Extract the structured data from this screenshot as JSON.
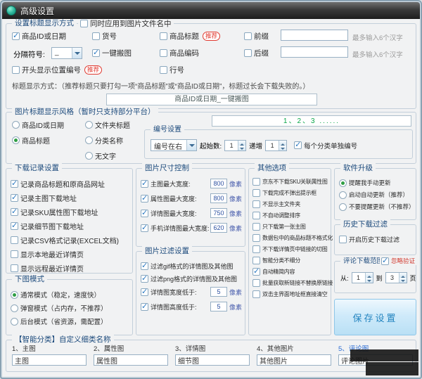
{
  "window": {
    "title": "高级设置"
  },
  "badges": {
    "recommend": "推荐"
  },
  "units": {
    "pixel": "像素",
    "max6": "最多输入6个汉字",
    "page": "页"
  },
  "title_setting": {
    "group_title": "设置标题显示方式",
    "apply_to_filename": {
      "label": "同时应用到图片文件名中",
      "checked": false
    },
    "id_date": {
      "label": "商品ID或日期",
      "checked": true
    },
    "item_no": {
      "label": "货号",
      "checked": false
    },
    "product_title": {
      "label": "商品标题",
      "checked": false
    },
    "prefix": {
      "label": "前缀",
      "checked": false,
      "value": ""
    },
    "separator": {
      "label": "分隔符号:",
      "value": "_"
    },
    "one_key": {
      "label": "一键搬图",
      "checked": true
    },
    "product_code": {
      "label": "商品编码",
      "checked": false
    },
    "suffix": {
      "label": "后缀",
      "checked": false,
      "value": ""
    },
    "position_no": {
      "label": "开头显示位置编号",
      "checked": false
    },
    "line_no": {
      "label": "行号",
      "checked": false
    },
    "hint": "标题显示方式：（推荐标题只要打勾一项“商品标题”或“商品ID或日期”，标题过长会下载失败的。）",
    "preview": "商品ID或日期_一键搬图"
  },
  "style_group": {
    "group_title": "图片标题显示风格（暂时只支持部分平台）",
    "options": [
      {
        "label": "商品ID或日期",
        "selected": false
      },
      {
        "label": "文件夹标题",
        "selected": false
      },
      {
        "label": "商品标题",
        "selected": true
      },
      {
        "label": "分类名称",
        "selected": false
      },
      {
        "label": "无文字",
        "selected": false
      }
    ]
  },
  "numbering": {
    "group_title": "编号设置",
    "preview": "1、2、3 ......",
    "position": "编号在右",
    "start_label": "起始数:",
    "start_value": "1",
    "step_label": "递增",
    "step_value": "1",
    "per_category": {
      "label": "每个分类单独编号",
      "checked": true
    }
  },
  "record_group": {
    "group_title": "下载记录设置",
    "items": [
      {
        "label": "记录商品标题和原商品网址",
        "checked": true
      },
      {
        "label": "记录主图下载地址",
        "checked": true
      },
      {
        "label": "记录SKU属性图下载地址",
        "checked": true
      },
      {
        "label": "记录细节图下载地址",
        "checked": true
      },
      {
        "label": "记录CSV格式记录(EXCEL文档)",
        "checked": false
      },
      {
        "label": "显示本地最近详情页",
        "checked": false
      },
      {
        "label": "显示远程最近详情页",
        "checked": false
      }
    ]
  },
  "mode_group": {
    "group_title": "下图模式",
    "options": [
      {
        "label": "通常模式（稳定，速度快）",
        "selected": true
      },
      {
        "label": "弹窗模式（占内存，不推荐）",
        "selected": false
      },
      {
        "label": "后台模式（省资源，需配置）",
        "selected": false
      }
    ]
  },
  "size_group": {
    "group_title": "图片尺寸控制",
    "rows": [
      {
        "label": "主图最大宽度:",
        "checked": true,
        "value": "800"
      },
      {
        "label": "属性图最大宽度:",
        "checked": true,
        "value": "800"
      },
      {
        "label": "详情图最大宽度:",
        "checked": true,
        "value": "750"
      },
      {
        "label": "手机详情图最大宽度:",
        "checked": true,
        "value": "620"
      }
    ]
  },
  "filter_group": {
    "group_title": "图片过滤设置",
    "checks": [
      {
        "label": "过滤gif格式的详情图及其他图",
        "checked": true
      },
      {
        "label": "过滤png格式的详情图及其他图",
        "checked": true
      }
    ],
    "rows": [
      {
        "label": "详情图宽度低于:",
        "checked": true,
        "value": "5"
      },
      {
        "label": "详情图高度低于:",
        "checked": true,
        "value": "5"
      }
    ]
  },
  "other_group": {
    "group_title": "其他选项",
    "items": [
      {
        "label": "京东不下载SKU关联属性图",
        "checked": false
      },
      {
        "label": "下载完成不弹出提示框",
        "checked": false
      },
      {
        "label": "不显示主文件夹",
        "checked": false
      },
      {
        "label": "不自动调整排序",
        "checked": false
      },
      {
        "label": "只下载第一张主图",
        "checked": false
      },
      {
        "label": "数据包中的商品标题不格式化",
        "checked": false
      },
      {
        "label": "不下载详情页中链接的切图",
        "checked": false
      },
      {
        "label": "智能分类不细分",
        "checked": false
      },
      {
        "label": "自动精简内容",
        "checked": true
      },
      {
        "label": "批量获取新链接不替换原链接",
        "checked": false
      },
      {
        "label": "双击主界面地址框直接清空",
        "checked": false
      }
    ]
  },
  "upgrade_group": {
    "group_title": "软件升级",
    "options": [
      {
        "label": "提醒我手动更新",
        "selected": true
      },
      {
        "label": "启动自动更新（推荐）",
        "selected": false
      },
      {
        "label": "不要提醒更新（不推荐）",
        "selected": false
      }
    ]
  },
  "history_group": {
    "group_title": "历史下载过滤",
    "item": {
      "label": "开启历史下载过滤",
      "checked": false
    }
  },
  "comment_group": {
    "group_title": "评论下载范围",
    "ignore": {
      "label": "忽略验证",
      "checked": true
    },
    "from_label": "从:",
    "from_value": "1",
    "to_label": "到",
    "to_value": "3"
  },
  "save_button": {
    "label": "保存设置"
  },
  "category_group": {
    "group_title": "【智能分类】自定义细类名称",
    "columns": [
      {
        "label": "1、主图",
        "value": "主图"
      },
      {
        "label": "2、属性图",
        "value": "属性图"
      },
      {
        "label": "3、详情图",
        "value": "细节图"
      },
      {
        "label": "4、其他图片",
        "value": "其他图片"
      },
      {
        "label": "5、评论图",
        "value": "评论图片"
      }
    ]
  }
}
